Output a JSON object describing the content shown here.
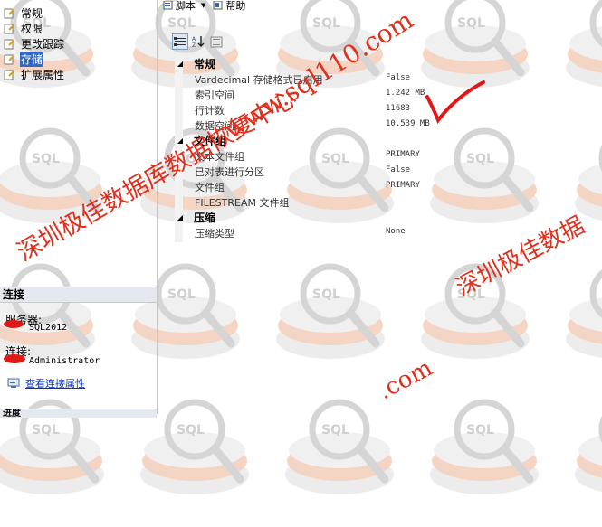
{
  "tree": {
    "items": [
      {
        "label": "常规",
        "icon": "page-icon",
        "selected": false
      },
      {
        "label": "权限",
        "icon": "page-icon",
        "selected": false
      },
      {
        "label": "更改跟踪",
        "icon": "page-icon",
        "selected": false
      },
      {
        "label": "存储",
        "icon": "page-icon",
        "selected": true
      },
      {
        "label": "扩展属性",
        "icon": "page-icon",
        "selected": false
      }
    ]
  },
  "connection": {
    "header": "连接",
    "server_label": "服务器:",
    "server_value": "SQL2012",
    "conn_label": "连接:",
    "conn_value": "Administrator",
    "view_link": "查看连接属性",
    "bottom_header": "进度"
  },
  "toolbar": {
    "script_label": "脚本",
    "help_label": "帮助"
  },
  "properties": {
    "categories": [
      {
        "name": "常规",
        "rows": [
          {
            "name": "Vardecimal 存储格式已启用",
            "value": "False"
          },
          {
            "name": "索引空间",
            "value": "1.242 MB"
          },
          {
            "name": "行计数",
            "value": "11683"
          },
          {
            "name": "数据空间",
            "value": "10.539 MB"
          }
        ]
      },
      {
        "name": "文件组",
        "rows": [
          {
            "name": "文本文件组",
            "value": "PRIMARY"
          },
          {
            "name": "已对表进行分区",
            "value": "False"
          },
          {
            "name": "文件组",
            "value": "PRIMARY"
          },
          {
            "name": "FILESTREAM 文件组",
            "value": ""
          }
        ]
      },
      {
        "name": "压缩",
        "rows": [
          {
            "name": "压缩类型",
            "value": "None"
          }
        ]
      }
    ]
  },
  "watermarks": {
    "url_text": "www.sql110.com",
    "site_text": "深圳极佳数据库数据恢复中心",
    "site_text2": "深圳极佳数据",
    "dot_com": ".com",
    "logo_text": "SQL"
  },
  "colors": {
    "selection": "#316ac5",
    "link": "#0033cc",
    "watermark_red": "#e0301e"
  }
}
